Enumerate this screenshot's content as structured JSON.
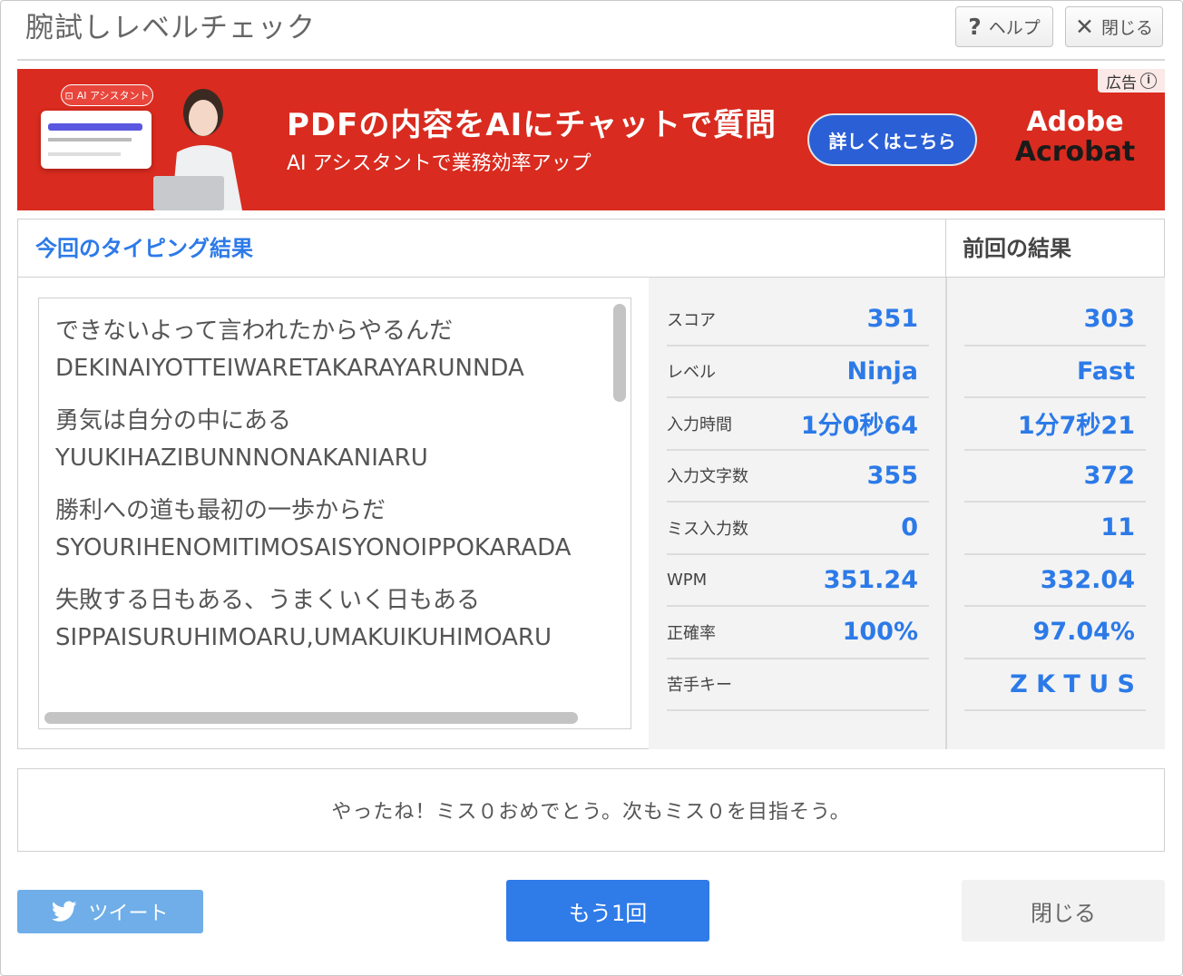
{
  "header": {
    "title": "腕試しレベルチェック",
    "help_label": "ヘルプ",
    "close_label": "閉じる"
  },
  "ad": {
    "pill": "AI アシスタント",
    "headline": "PDFの内容をAIにチャットで質問",
    "subline": "AI アシスタントで業務効率アップ",
    "cta": "詳しくはこちら",
    "brand_line1": "Adobe",
    "brand_line2": "Acrobat",
    "tag": "広告",
    "bg_color": "#d92b1f"
  },
  "results": {
    "current_title": "今回のタイピング結果",
    "previous_title": "前回の結果",
    "log": [
      {
        "jp": "できないよって言われたからやるんだ",
        "ro": "DEKINAIYOTTEIWARETAKARAYARUNNDA"
      },
      {
        "jp": "勇気は自分の中にある",
        "ro": "YUUKIHAZIBUNNNONAKANIARU"
      },
      {
        "jp": "勝利への道も最初の一歩からだ",
        "ro": "SYOURIHENOMITIMOSAISYONOIPPOKARADA"
      },
      {
        "jp": "失敗する日もある、うまくいく日もある",
        "ro": "SIPPAISURUHIMOARU,UMAKUIKUHIMOARU"
      }
    ],
    "stats": [
      {
        "label": "スコア",
        "current": "351",
        "previous": "303"
      },
      {
        "label": "レベル",
        "current": "Ninja",
        "previous": "Fast"
      },
      {
        "label": "入力時間",
        "current": "1分0秒64",
        "previous": "1分7秒21"
      },
      {
        "label": "入力文字数",
        "current": "355",
        "previous": "372"
      },
      {
        "label": "ミス入力数",
        "current": "0",
        "previous": "11"
      },
      {
        "label": "WPM",
        "current": "351.24",
        "previous": "332.04"
      },
      {
        "label": "正確率",
        "current": "100%",
        "previous": "97.04%"
      },
      {
        "label": "苦手キー",
        "current": "",
        "previous": "Z K T U S"
      }
    ]
  },
  "message": "やったね！ミス０おめでとう。次もミス０を目指そう。",
  "footer": {
    "tweet_label": "ツイート",
    "again_label": "もう1回",
    "close_label": "閉じる"
  },
  "colors": {
    "accent": "#2c7ae8",
    "tweet": "#6faee8",
    "primary_button": "#2f7be8"
  }
}
